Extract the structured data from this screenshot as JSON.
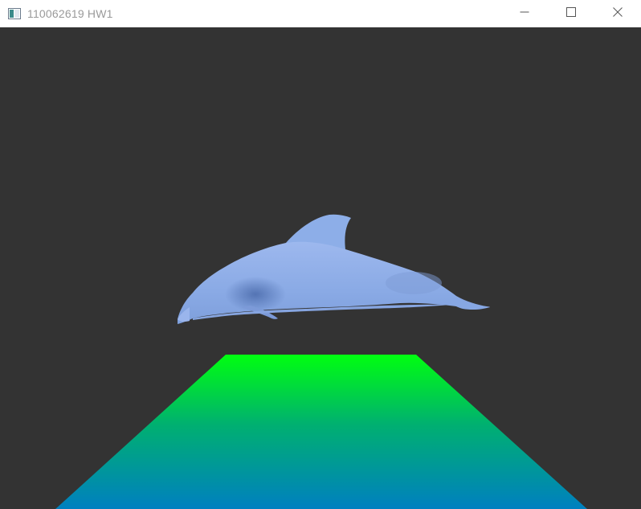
{
  "window": {
    "title": "110062619 HW1",
    "icon": "app-window-icon",
    "controls": {
      "minimize_icon": "minimize-icon",
      "maximize_icon": "maximize-icon",
      "close_icon": "close-icon"
    }
  },
  "scene": {
    "background_color": "#333333",
    "model": "dolphin",
    "model_color": "#8AAAE5",
    "model_shadow_color": "#5C7BB8",
    "ground": "plane",
    "ground_gradient": {
      "far_color": "#00FF10",
      "near_color": "#0080C0"
    }
  }
}
